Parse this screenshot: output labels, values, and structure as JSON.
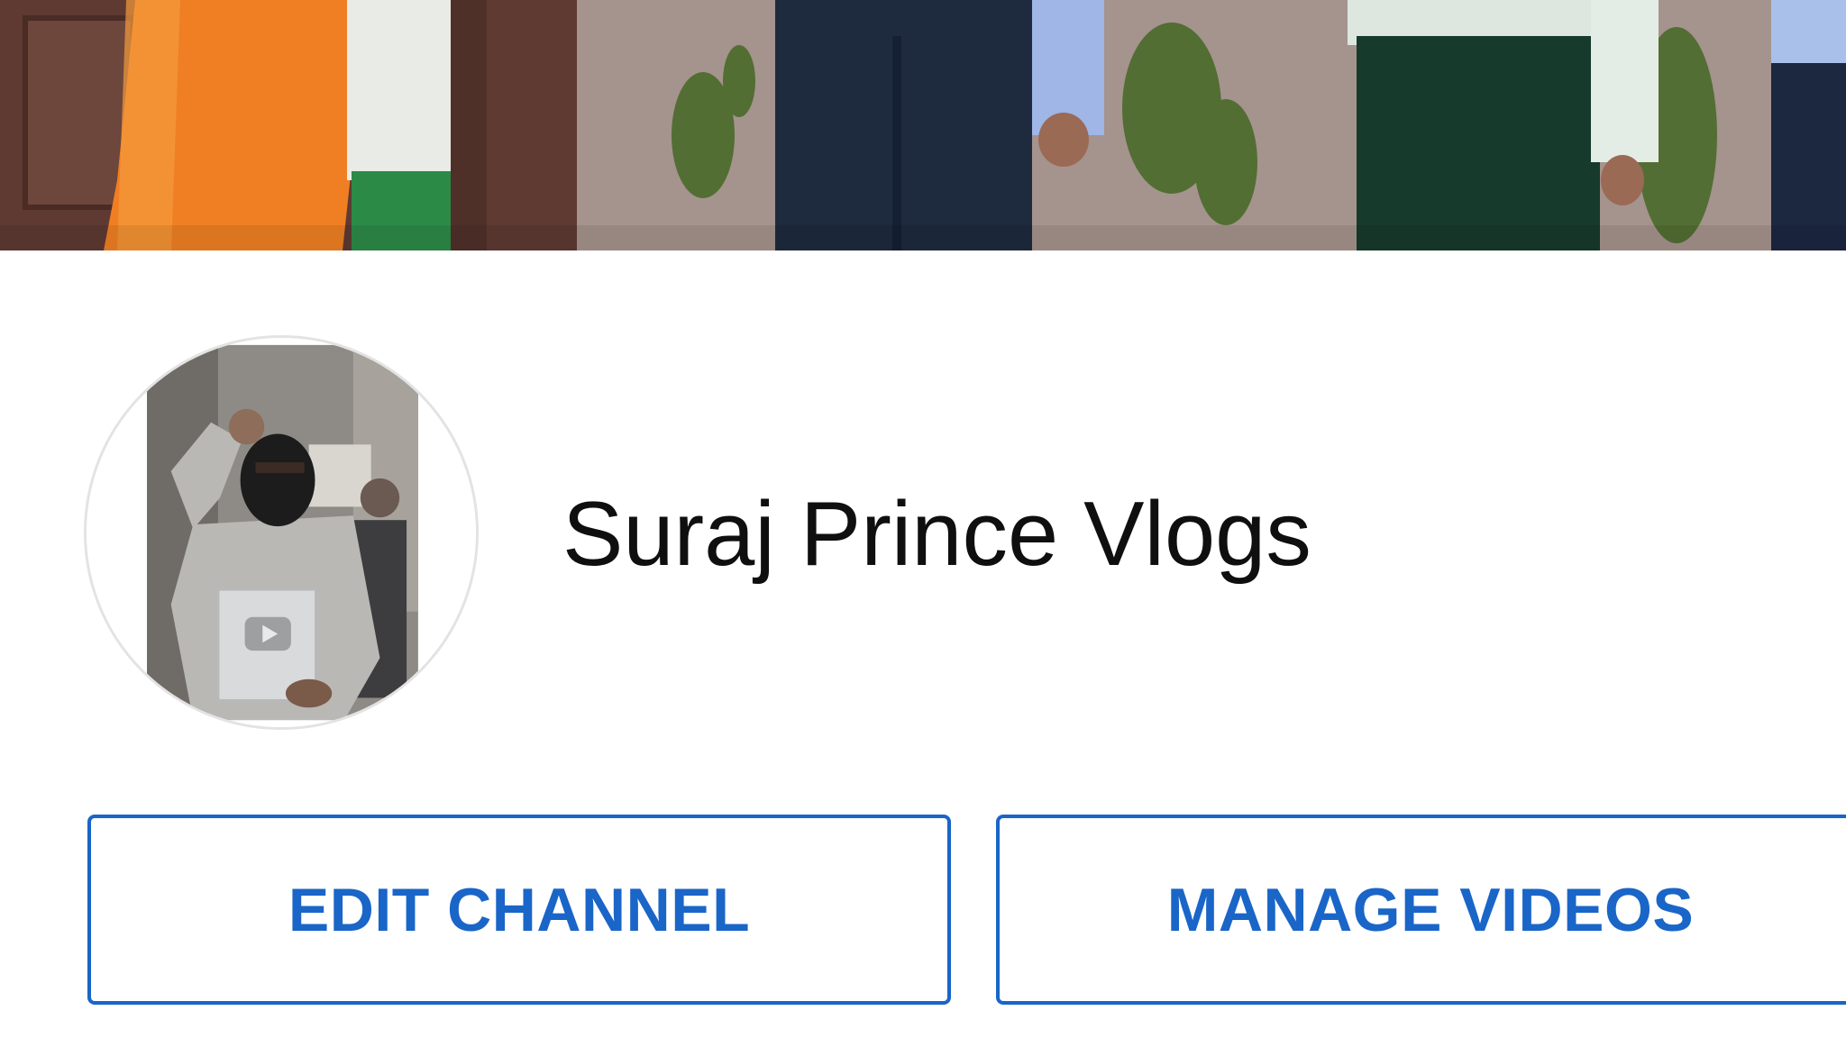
{
  "channel": {
    "name": "Suraj Prince Vlogs",
    "banner_image": "channel-banner-photo",
    "avatar_image": "channel-avatar-photo"
  },
  "actions": {
    "edit_label": "EDIT CHANNEL",
    "manage_label": "MANAGE VIDEOS"
  },
  "colors": {
    "accent": "#1a65c8",
    "text": "#0f0f0f",
    "background": "#ffffff",
    "avatar_border": "#e3e3e3"
  }
}
